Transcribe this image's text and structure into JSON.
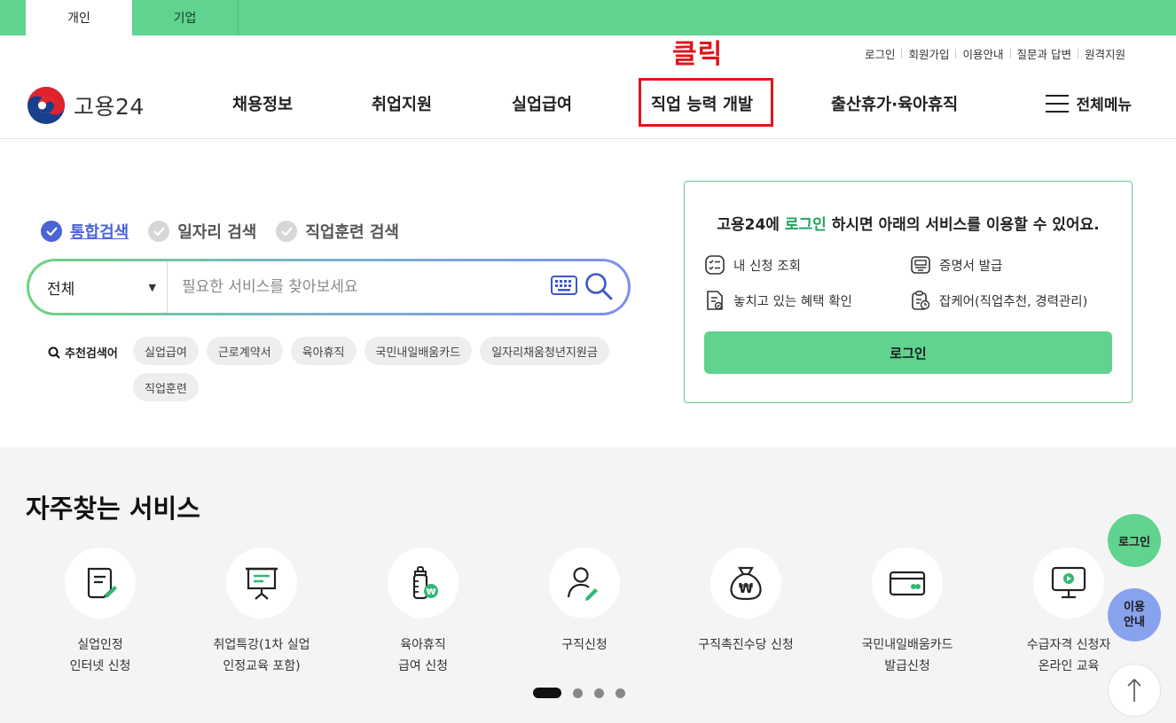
{
  "top_tabs": [
    {
      "label": "개인",
      "active": true
    },
    {
      "label": "기업",
      "active": false
    }
  ],
  "annotation": {
    "text": "클릭",
    "color": "#e0151a"
  },
  "util_links": [
    "로그인",
    "회원가입",
    "이용안내",
    "질문과 답변",
    "원격지원"
  ],
  "logo": {
    "text": "고용24"
  },
  "gnb": [
    {
      "label": "채용정보"
    },
    {
      "label": "취업지원"
    },
    {
      "label": "실업급여"
    },
    {
      "label": "직업 능력 개발",
      "highlighted": true
    },
    {
      "label": "출산휴가·육아휴직"
    }
  ],
  "all_menu": {
    "label": "전체메뉴",
    "icon": "hamburger-icon"
  },
  "search": {
    "types": [
      {
        "label": "통합검색",
        "selected": true
      },
      {
        "label": "일자리 검색",
        "selected": false
      },
      {
        "label": "직업훈련 검색",
        "selected": false
      }
    ],
    "scope": "전체",
    "placeholder": "필요한 서비스를 찾아보세요",
    "recommend_label": "추천검색어",
    "chips": [
      "실업급여",
      "근로계약서",
      "육아휴직",
      "국민내일배움카드",
      "일자리채움청년지원금",
      "직업훈련"
    ]
  },
  "login_card": {
    "title_prefix": "고용24에 ",
    "title_highlight": "로그인",
    "title_suffix": " 하시면 아래의 서비스를 이용할 수 있어요.",
    "services": [
      {
        "label": "내 신청 조회",
        "icon": "checklist-icon"
      },
      {
        "label": "증명서 발급",
        "icon": "certificate-icon"
      },
      {
        "label": "놓치고 있는 혜택 확인",
        "icon": "benefit-doc-icon"
      },
      {
        "label": "잡케어(직업추천, 경력관리)",
        "icon": "clipboard-clock-icon"
      }
    ],
    "button": "로그인",
    "accent": "#5fd38f"
  },
  "frequent": {
    "title": "자주찾는 서비스",
    "items": [
      {
        "label": "실업인정\n인터넷 신청",
        "icon": "document-pen-icon"
      },
      {
        "label": "취업특강(1차 실업\n인정교육 포함)",
        "icon": "presentation-board-icon"
      },
      {
        "label": "육아휴직\n급여 신청",
        "icon": "baby-bottle-won-icon"
      },
      {
        "label": "구직신청",
        "icon": "person-pen-icon"
      },
      {
        "label": "구직촉진수당 신청",
        "icon": "money-bag-won-icon"
      },
      {
        "label": "국민내일배움카드\n발급신청",
        "icon": "card-icon"
      },
      {
        "label": "수급자격 신청자\n온라인 교육",
        "icon": "monitor-play-icon"
      }
    ],
    "pager": {
      "current": 1,
      "total": 4
    }
  },
  "floating": {
    "login": "로그인",
    "guide": "이용\n안내",
    "top_icon": "arrow-up-icon"
  }
}
